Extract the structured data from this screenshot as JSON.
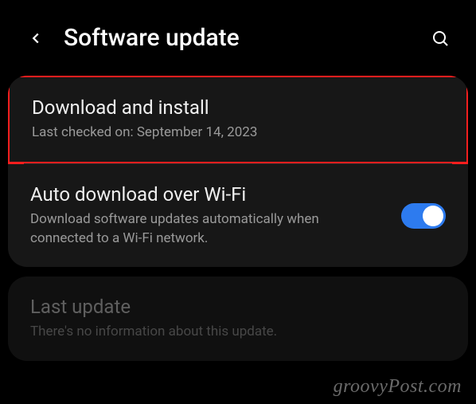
{
  "header": {
    "title": "Software update"
  },
  "items": {
    "download": {
      "title": "Download and install",
      "subtitle": "Last checked on: September 14, 2023"
    },
    "autoDownload": {
      "title": "Auto download over Wi-Fi",
      "subtitle": "Download software updates automatically when connected to a Wi-Fi network.",
      "toggle": true
    },
    "lastUpdate": {
      "title": "Last update",
      "subtitle": "There's no information about this update."
    }
  },
  "watermark": "groovyPost.com"
}
